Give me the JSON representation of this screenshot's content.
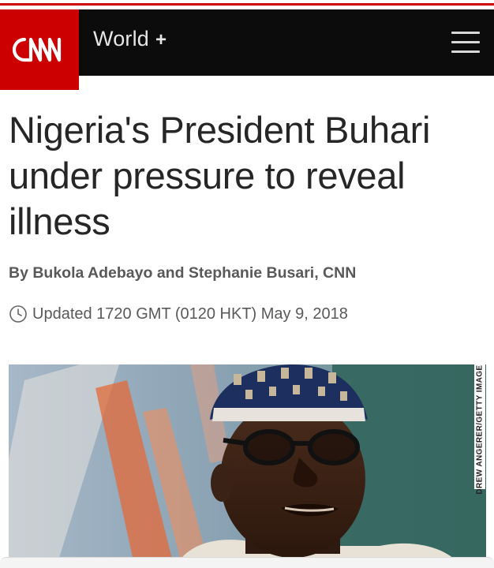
{
  "header": {
    "logo_text": "CNN",
    "section_label": "World",
    "section_plus": "+",
    "menu_icon": "hamburger-menu-icon",
    "brand_red": "#cc0000",
    "bar_color": "#0c0c0c"
  },
  "article": {
    "headline": "Nigeria's President Buhari under pressure to reveal illness",
    "byline": "By Bukola Adebayo and Stephanie Busari, CNN",
    "updated_icon": "clock-icon",
    "updated": "Updated 1720 GMT (0120 HKT) May 9, 2018"
  },
  "photo": {
    "credit": "DREW ANGERER/GETTY IMAGES"
  }
}
